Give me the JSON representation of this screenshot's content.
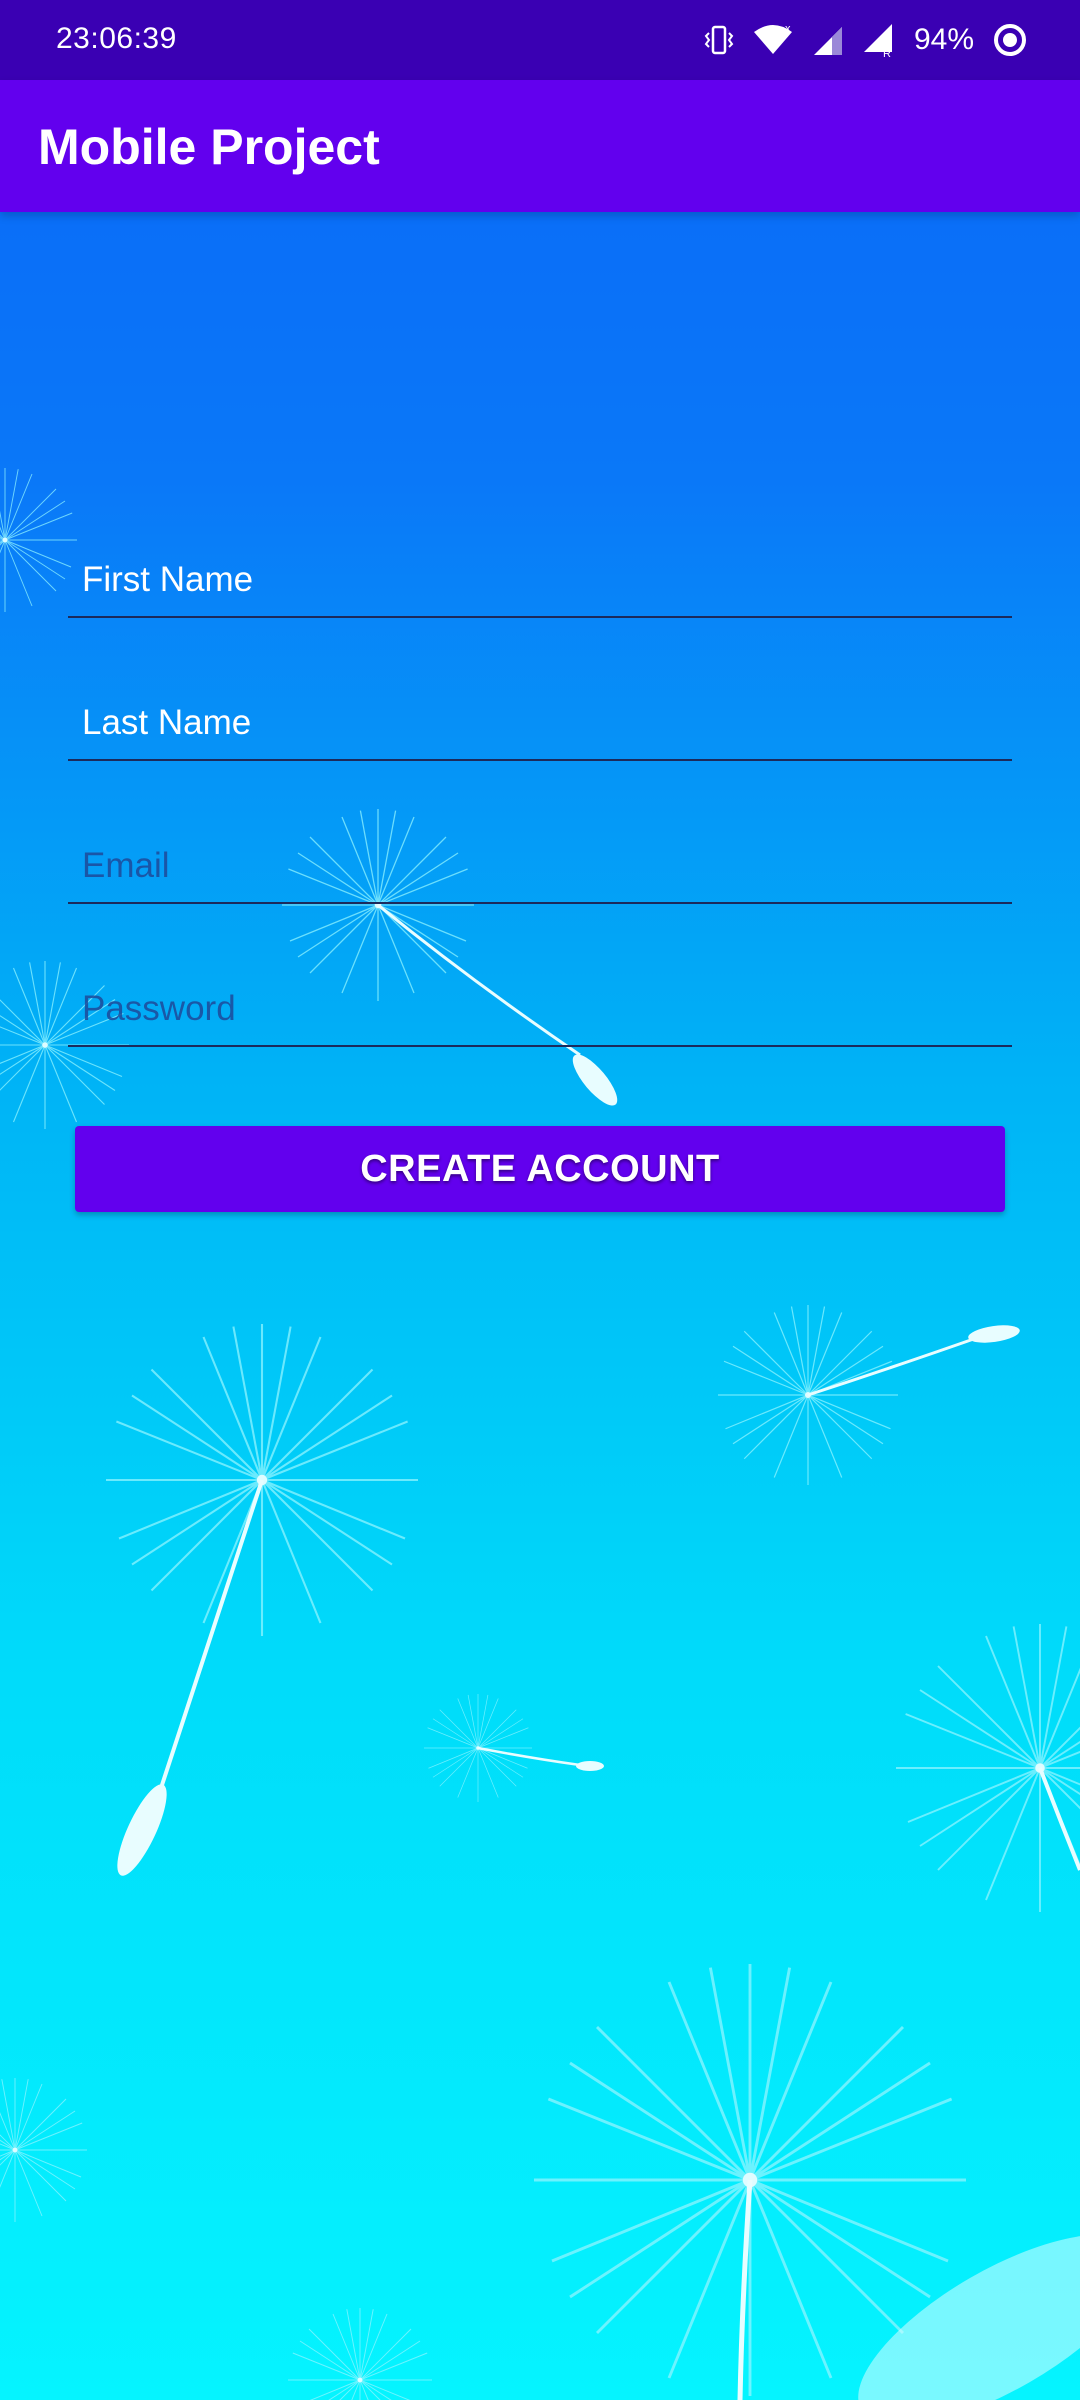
{
  "status_bar": {
    "time": "23:06:39",
    "battery_percent": "94%",
    "icons": [
      "vibrate-icon",
      "wifi-icon",
      "signal-icon",
      "signal-roaming-icon",
      "sync-icon"
    ]
  },
  "app_bar": {
    "title": "Mobile Project"
  },
  "form": {
    "first_name": {
      "placeholder": "First Name",
      "value": ""
    },
    "last_name": {
      "placeholder": "Last Name",
      "value": ""
    },
    "email": {
      "placeholder": "Email",
      "value": ""
    },
    "password": {
      "placeholder": "Password",
      "value": ""
    },
    "create_button_label": "CREATE ACCOUNT"
  },
  "colors": {
    "status_bar": "#3a00b3",
    "app_bar": "#6200ee",
    "button": "#6200ee",
    "background_top": "#0a67f7",
    "background_bottom": "#05f4ff"
  }
}
